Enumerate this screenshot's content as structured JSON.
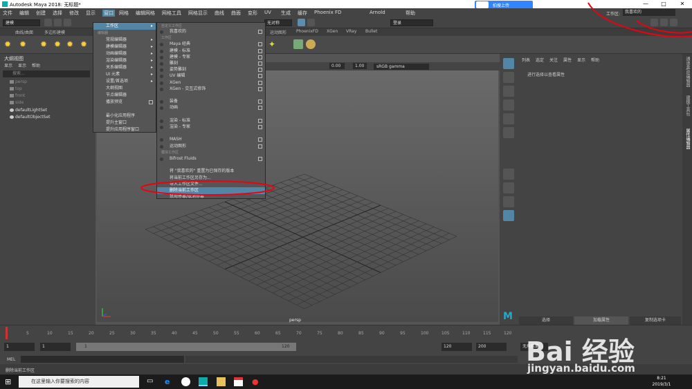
{
  "titlebar": {
    "title": "Autodesk Maya 2018: 无标题*",
    "minimize": "—",
    "maximize": "□",
    "close": "✕"
  },
  "baidu_button": "拍搜上传",
  "menubar": [
    "文件",
    "编辑",
    "创建",
    "选择",
    "修改",
    "显示",
    "窗口",
    "网格",
    "编辑网格",
    "网格工具",
    "网格显示",
    "曲线",
    "曲面",
    "变形",
    "UV",
    "生成",
    "缓存",
    "Phoenix FD",
    "Arnold",
    "帮助"
  ],
  "shelfbar": {
    "mode_dropdown": "建模",
    "symmetry_label": "无对称",
    "login_dropdown": "登录"
  },
  "shelf_tabs": [
    "曲线/曲面",
    "多边形建模",
    "运动图形",
    "PhoenixFD",
    "XGen",
    "VRay",
    "Bullet"
  ],
  "workspace": {
    "label": "工作区:",
    "value": "我喜欢的"
  },
  "outliner": {
    "title": "大纲视图",
    "menus": [
      "显示",
      "显示",
      "帮助"
    ],
    "search_placeholder": "搜索...",
    "items": [
      {
        "name": "persp",
        "visible": false
      },
      {
        "name": "top",
        "visible": false
      },
      {
        "name": "front",
        "visible": false
      },
      {
        "name": "side",
        "visible": false
      },
      {
        "name": "defaultLightSet",
        "visible": true
      },
      {
        "name": "defaultObjectSet",
        "visible": true
      }
    ]
  },
  "window_menu": {
    "items": [
      {
        "label": "工作区",
        "arrow": true,
        "highlight": true
      },
      {
        "label": "编辑器",
        "section": true
      },
      {
        "label": "常规编辑器",
        "arrow": true
      },
      {
        "label": "建模编辑器",
        "arrow": true
      },
      {
        "label": "动画编辑器",
        "arrow": true
      },
      {
        "label": "渲染编辑器",
        "arrow": true
      },
      {
        "label": "关系编辑器",
        "arrow": true
      },
      {
        "label": "UI 元素",
        "arrow": true
      },
      {
        "label": "设置/首选项",
        "arrow": true
      },
      {
        "label": "大纲视图"
      },
      {
        "label": "节点编辑器"
      },
      {
        "label": "播放预览",
        "checkbox": true
      },
      {
        "label": ""
      },
      {
        "label": "最小化应用程序"
      },
      {
        "label": "提升主窗口"
      },
      {
        "label": "提升应用程序窗口"
      }
    ]
  },
  "workspace_menu": {
    "items": [
      {
        "label": "我喜欢的",
        "section_before": "自定义工作区"
      },
      {
        "label": "工作区",
        "section": true
      },
      {
        "label": "Maya 经典"
      },
      {
        "label": "建模 - 标准"
      },
      {
        "label": "建模 - 专家"
      },
      {
        "label": "雕刻"
      },
      {
        "label": "姿势雕刻"
      },
      {
        "label": "UV 编辑"
      },
      {
        "label": "XGen"
      },
      {
        "label": "XGen - 交互式修饰"
      },
      {
        "label": ""
      },
      {
        "label": "装备"
      },
      {
        "label": "动画"
      },
      {
        "label": ""
      },
      {
        "label": "渲染 - 标准"
      },
      {
        "label": "渲染 - 专家"
      },
      {
        "label": ""
      },
      {
        "label": "MASH"
      },
      {
        "label": "运动图形"
      },
      {
        "label": "模块工作区",
        "section": true
      },
      {
        "label": "Bifrost Fluids"
      },
      {
        "label": ""
      },
      {
        "label": "将 \"我喜欢的\" 重置为已保存的版本"
      },
      {
        "label": "将当前工作区另存为..."
      },
      {
        "label": "导入工作区文件..."
      },
      {
        "label": "删除当前工作区",
        "highlight": true
      },
      {
        "label": "禁用停靠/取消停靠"
      }
    ]
  },
  "viewport": {
    "menus": [
      "视图",
      "着色",
      "照明",
      "显示",
      "渲染器",
      "面板"
    ],
    "exposure": "0.00",
    "gamma_value": "1.00",
    "color_space": "sRGB gamma",
    "camera": "persp"
  },
  "attribute_editor": {
    "menus": [
      "列表",
      "选定",
      "关注",
      "属性",
      "显示",
      "帮助"
    ],
    "empty_text": "进行选择以查看属性",
    "tabs": [
      "选择",
      "加载属性",
      "复制选项卡"
    ]
  },
  "right_tabs": [
    "通道盒/层编辑器",
    "建模工具包",
    "属性编辑器"
  ],
  "timeline": {
    "ticks": [
      "1",
      "5",
      "10",
      "15",
      "20",
      "25",
      "30",
      "35",
      "40",
      "45",
      "50",
      "55",
      "60",
      "65",
      "70",
      "75",
      "80",
      "85",
      "90",
      "95",
      "100",
      "105",
      "110",
      "115",
      "120"
    ],
    "current_frame": "1"
  },
  "range": {
    "start": "1",
    "start2": "1",
    "slider_start": "1",
    "slider_end": "120",
    "end": "120",
    "end2": "200",
    "char_set": "无角色集"
  },
  "mel": {
    "label": "MEL"
  },
  "status": {
    "text": "删除当前工作区"
  },
  "taskbar": {
    "search": "在这里输入你要搜索的内容",
    "time": "8:21",
    "date": "2019/3/1"
  },
  "watermark": {
    "logo": "Bai 经验",
    "url": "jingyan.baidu.com"
  }
}
